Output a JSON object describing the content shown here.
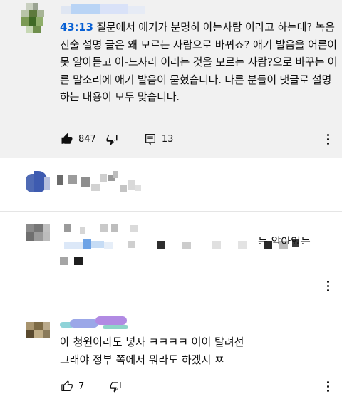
{
  "comments": [
    {
      "timestamp": "43:13",
      "text": "질문에서 애기가 분명히 아는사람 이라고 하는데? 녹음 진술 설명 글은 왜 모르는 사람으로 바뀌죠? 애기 발음을 어른이 못 알아듣고 아-느사라 이러는 것을 모르는 사람?으로 바꾸는 어른 말소리에 애기 발음이 묻혔습니다. 다른 분들이 댓글로 설명하는 내용이 모두 맞습니다.",
      "likes": "847",
      "replies": "13"
    },
    {},
    {
      "partial_visible_text": "는 알아었는"
    },
    {
      "text_line1": "아 청원이라도 넣자 ㅋㅋㅋㅋ 어이 탈려선",
      "text_line2": "그래야 정부 쪽에서 뭐라도 하겠지 ㅉ",
      "likes": "7"
    }
  ],
  "icons": {
    "like": "thumbs-up-icon",
    "dislike": "thumbs-down-icon",
    "reply": "reply-icon",
    "more": "more-vert-icon"
  },
  "colors": {
    "timestamp": "#065fd4",
    "highlighted_bg": "#f1f1f1",
    "text": "#0f0f0f"
  }
}
